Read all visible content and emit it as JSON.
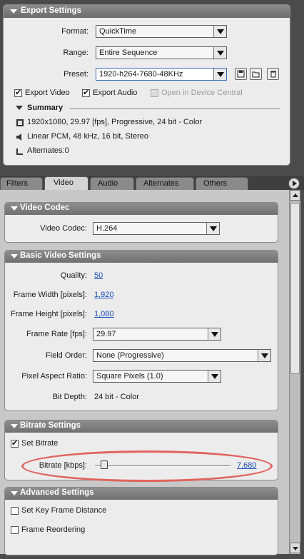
{
  "export_settings": {
    "title": "Export Settings",
    "format_label": "Format:",
    "format_value": "QuickTime",
    "range_label": "Range:",
    "range_value": "Entire Sequence",
    "preset_label": "Preset:",
    "preset_value": "1920-h264-7680-48KHz",
    "export_video_label": "Export Video",
    "export_audio_label": "Export Audio",
    "open_device_central_label": "Open in Device Central",
    "summary_label": "Summary",
    "summary_lines": [
      "1920x1080, 29.97 [fps], Progressive, 24 bit - Color",
      "Linear PCM, 48 kHz, 16 bit, Stereo",
      "Alternates:0"
    ]
  },
  "tabs": [
    "Filters",
    "Video",
    "Audio",
    "Alternates",
    "Others"
  ],
  "active_tab": "Video",
  "video_codec": {
    "title": "Video Codec",
    "codec_label": "Video Codec:",
    "codec_value": "H.264"
  },
  "basic_video": {
    "title": "Basic Video Settings",
    "quality_label": "Quality:",
    "quality_value": "50",
    "frame_width_label": "Frame Width [pixels]:",
    "frame_width_value": "1,920",
    "frame_height_label": "Frame Height [pixels]:",
    "frame_height_value": "1,080",
    "frame_rate_label": "Frame Rate [fps]:",
    "frame_rate_value": "29.97",
    "field_order_label": "Field Order:",
    "field_order_value": "None (Progressive)",
    "pixel_aspect_label": "Pixel Aspect Ratio:",
    "pixel_aspect_value": "Square Pixels (1.0)",
    "bit_depth_label": "Bit Depth:",
    "bit_depth_value": "24 bit - Color"
  },
  "bitrate": {
    "title": "Bitrate Settings",
    "set_bitrate_label": "Set Bitrate",
    "bitrate_label": "Bitrate [kbps]:",
    "bitrate_value": "7,680"
  },
  "advanced": {
    "title": "Advanced Settings",
    "key_frame_label": "Set Key Frame Distance",
    "frame_reorder_label": "Frame Reordering"
  },
  "colors": {
    "highlight_ellipse": "#e0645f",
    "link": "#1a4fb8"
  }
}
